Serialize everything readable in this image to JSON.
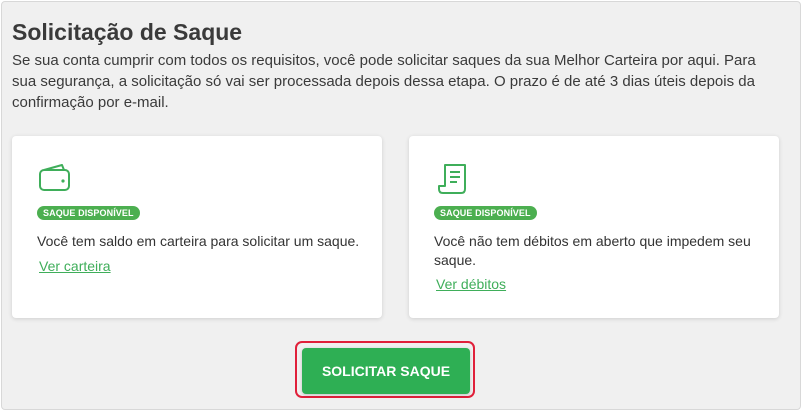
{
  "header": {
    "title": "Solicitação de Saque",
    "description": "Se sua conta cumprir com todos os requisitos, você pode solicitar saques da sua Melhor Carteira por aqui. Para sua segurança, a solicitação só vai ser processada depois dessa etapa. O prazo é de até 3 dias úteis depois da confirmação por e-mail."
  },
  "cards": [
    {
      "icon": "wallet-icon",
      "badge": "SAQUE DISPONÍVEL",
      "text": "Você tem saldo em carteira para solicitar um saque.",
      "link": "Ver carteira"
    },
    {
      "icon": "receipt-icon",
      "badge": "SAQUE DISPONÍVEL",
      "text": "Você não tem débitos em aberto que impedem seu saque.",
      "link": "Ver débitos"
    }
  ],
  "action": {
    "button_label": "SOLICITAR SAQUE"
  },
  "colors": {
    "accent": "#2eaf54",
    "badge": "#4caf50",
    "highlight": "#e0203a"
  }
}
